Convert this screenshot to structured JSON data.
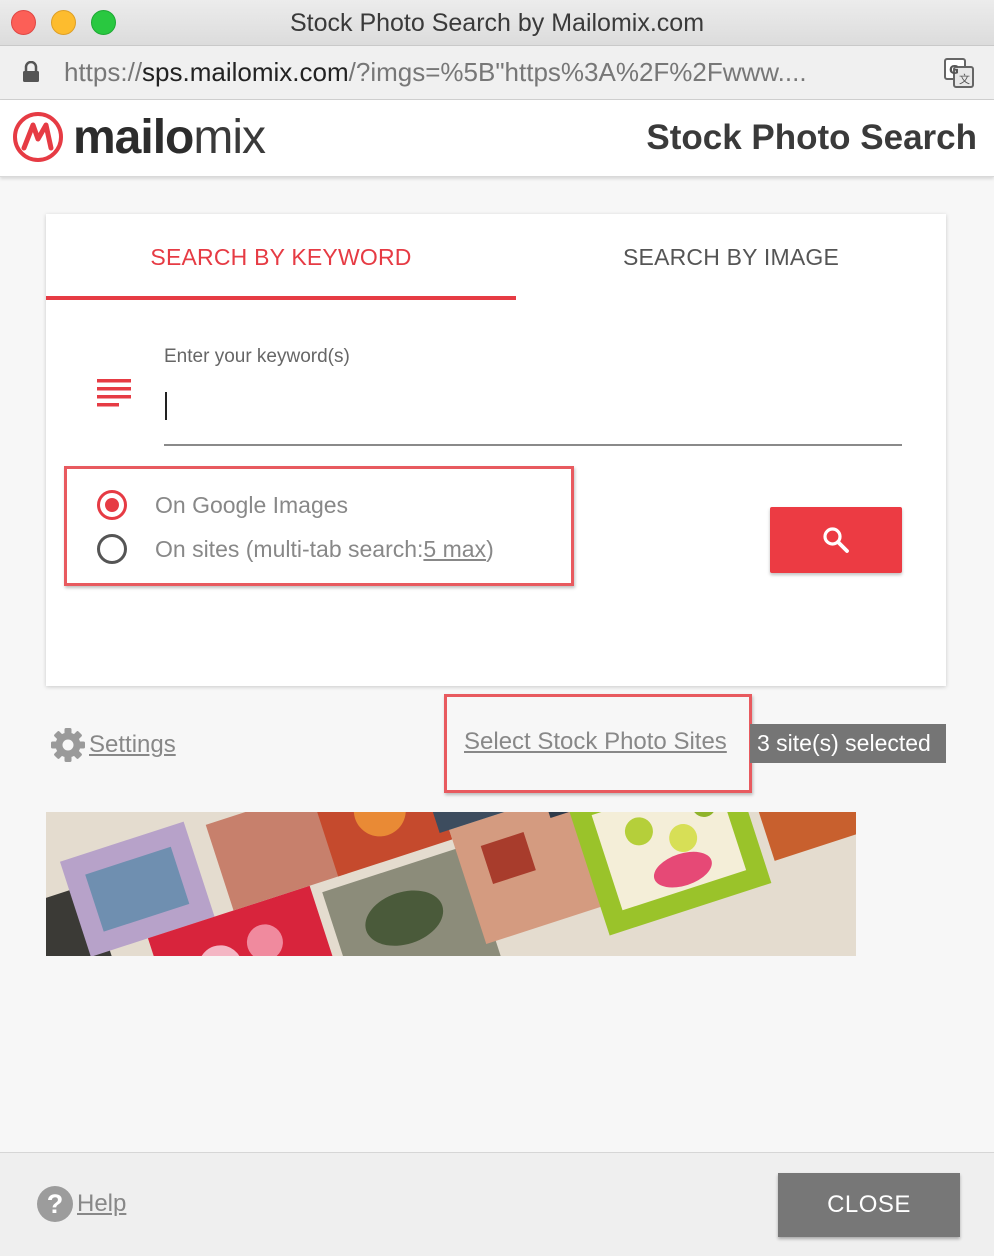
{
  "window": {
    "title": "Stock Photo Search by Mailomix.com",
    "url_prefix": "https://",
    "url_host": "sps.mailomix.com",
    "url_rest": "/?imgs=%5B\"https%3A%2F%2Fwww...."
  },
  "header": {
    "logo_bold": "mailo",
    "logo_light": "mix",
    "title": "Stock Photo Search"
  },
  "tabs": [
    {
      "label": "SEARCH BY KEYWORD",
      "active": true
    },
    {
      "label": "SEARCH BY IMAGE",
      "active": false
    }
  ],
  "search": {
    "label": "Enter your keyword(s)",
    "value": "",
    "options": [
      {
        "label": "On Google Images",
        "checked": true
      },
      {
        "label_prefix": "On sites (multi-tab search: ",
        "link": "5 max",
        "label_suffix": ")",
        "checked": false
      }
    ]
  },
  "settings_label": "Settings",
  "sites": {
    "link_label": "Select Stock Photo Sites",
    "badge": "3 site(s) selected"
  },
  "footer": {
    "help_label": "Help",
    "close_label": "CLOSE"
  },
  "colors": {
    "accent": "#e63b44",
    "highlight_box": "#e85a5f",
    "badge_bg": "#757575",
    "close_bg": "#777777"
  }
}
